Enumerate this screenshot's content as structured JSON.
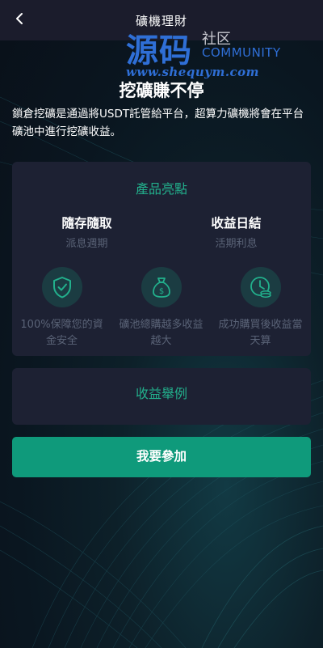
{
  "nav": {
    "title": "礦機理財",
    "back_icon": "chevron-left-icon"
  },
  "watermark": {
    "main": "源码",
    "she": "社区",
    "community": "COMMUNITY",
    "url": "www.shequym.com"
  },
  "hero": {
    "title": "挖礦賺不停",
    "description": "鎖倉挖礦是通過將USDT託管給平台，超算力礦機將會在平台礦池中進行挖礦收益。"
  },
  "highlights": {
    "title": "產品亮點",
    "columns": [
      {
        "title": "隨存隨取",
        "subtitle": "派息週期"
      },
      {
        "title": "收益日結",
        "subtitle": "活期利息"
      }
    ],
    "features": [
      {
        "icon": "shield-check-icon",
        "text": "100%保障您的資金安全"
      },
      {
        "icon": "money-bag-icon",
        "text": "礦池總購越多收益越大"
      },
      {
        "icon": "coin-clock-icon",
        "text": "成功購買後收益當天算"
      }
    ]
  },
  "example": {
    "title": "收益舉例"
  },
  "join_button": {
    "label": "我要參加"
  },
  "colors": {
    "accent": "#22b08c",
    "button": "#0f9a7b",
    "card": "#1d2133",
    "nav": "#1b1c2c",
    "muted_text": "#5a6377",
    "watermark": "#2f6fd6"
  }
}
